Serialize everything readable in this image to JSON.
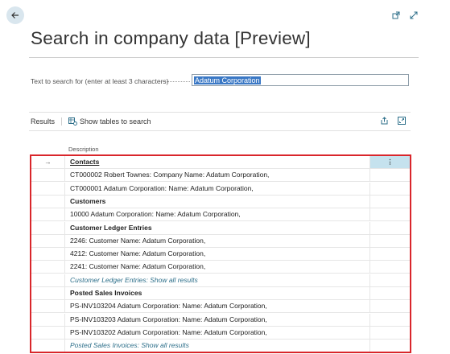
{
  "page": {
    "title": "Search in company data [Preview]"
  },
  "search": {
    "label": "Text to search for (enter at least 3 characters)",
    "value": "Adatum Corporation"
  },
  "results": {
    "tab_label": "Results",
    "show_tables_label": "Show tables to search",
    "column_header": "Description",
    "rows": [
      {
        "type": "header",
        "text": "Contacts",
        "active": true
      },
      {
        "type": "item",
        "text": "CT000002 Robert Townes: Company Name: Adatum Corporation,"
      },
      {
        "type": "item",
        "text": "CT000001 Adatum Corporation: Name: Adatum Corporation,"
      },
      {
        "type": "header",
        "text": "Customers"
      },
      {
        "type": "item",
        "text": "10000 Adatum Corporation: Name: Adatum Corporation,"
      },
      {
        "type": "header",
        "text": "Customer Ledger Entries"
      },
      {
        "type": "item",
        "text": "2246: Customer Name: Adatum Corporation,"
      },
      {
        "type": "item",
        "text": "4212: Customer Name: Adatum Corporation,"
      },
      {
        "type": "item",
        "text": "2241: Customer Name: Adatum Corporation,"
      },
      {
        "type": "link",
        "text": "Customer Ledger Entries: Show all results"
      },
      {
        "type": "header",
        "text": "Posted Sales Invoices"
      },
      {
        "type": "item",
        "text": "PS-INV103204 Adatum Corporation: Name: Adatum Corporation,"
      },
      {
        "type": "item",
        "text": "PS-INV103203 Adatum Corporation: Name: Adatum Corporation,"
      },
      {
        "type": "item",
        "text": "PS-INV103202 Adatum Corporation: Name: Adatum Corporation,"
      },
      {
        "type": "link",
        "text": "Posted Sales Invoices: Show all results"
      }
    ]
  },
  "icons": {
    "back": "arrow-left-icon",
    "popout": "open-in-new-window-icon",
    "expand": "expand-icon",
    "share": "share-icon",
    "fullscreen": "fullscreen-icon",
    "row_arrow": "row-arrow-icon",
    "more": "more-options-icon"
  },
  "colors": {
    "highlight_border": "#d9262b",
    "active_cell": "#c5e2ee",
    "link": "#2d6f8a",
    "selection": "#3a78c5"
  }
}
